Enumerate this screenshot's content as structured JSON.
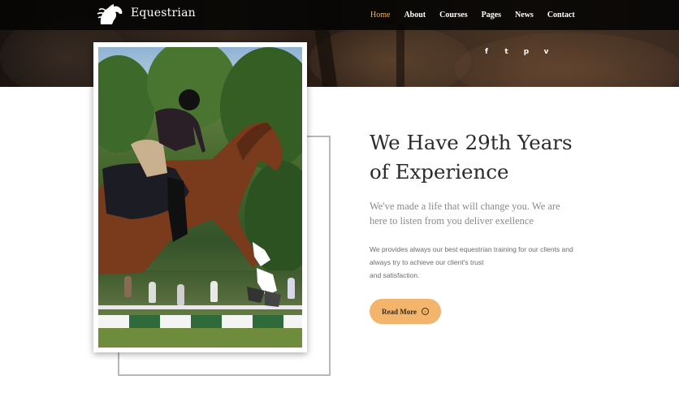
{
  "header": {
    "brand": "Equestrian",
    "nav": [
      {
        "label": "Home",
        "active": true
      },
      {
        "label": "About"
      },
      {
        "label": "Courses"
      },
      {
        "label": "Pages"
      },
      {
        "label": "News"
      },
      {
        "label": "Contact"
      }
    ],
    "social": [
      {
        "icon": "facebook-icon",
        "glyph": "f"
      },
      {
        "icon": "twitter-icon",
        "glyph": "t"
      },
      {
        "icon": "pinterest-icon",
        "glyph": "p"
      },
      {
        "icon": "vimeo-icon",
        "glyph": "v"
      }
    ]
  },
  "about": {
    "headline_line1": "We Have 29th Years",
    "headline_line2": "of Experience",
    "lead_line1": "We've made a life that will change you. We are",
    "lead_line2": "here to listen from you deliver exellence",
    "body_line1": "We provides always our best equestrian training for our clients and",
    "body_line2": "always try to achieve our client's trust",
    "body_line3": "and satisfaction.",
    "cta_label": "Read More"
  },
  "colors": {
    "accent": "#f2b063",
    "button_bg": "#f2b56b",
    "nav_bg": "#050403",
    "headline": "#2b2b2b",
    "muted_text": "#8a8a8a"
  }
}
